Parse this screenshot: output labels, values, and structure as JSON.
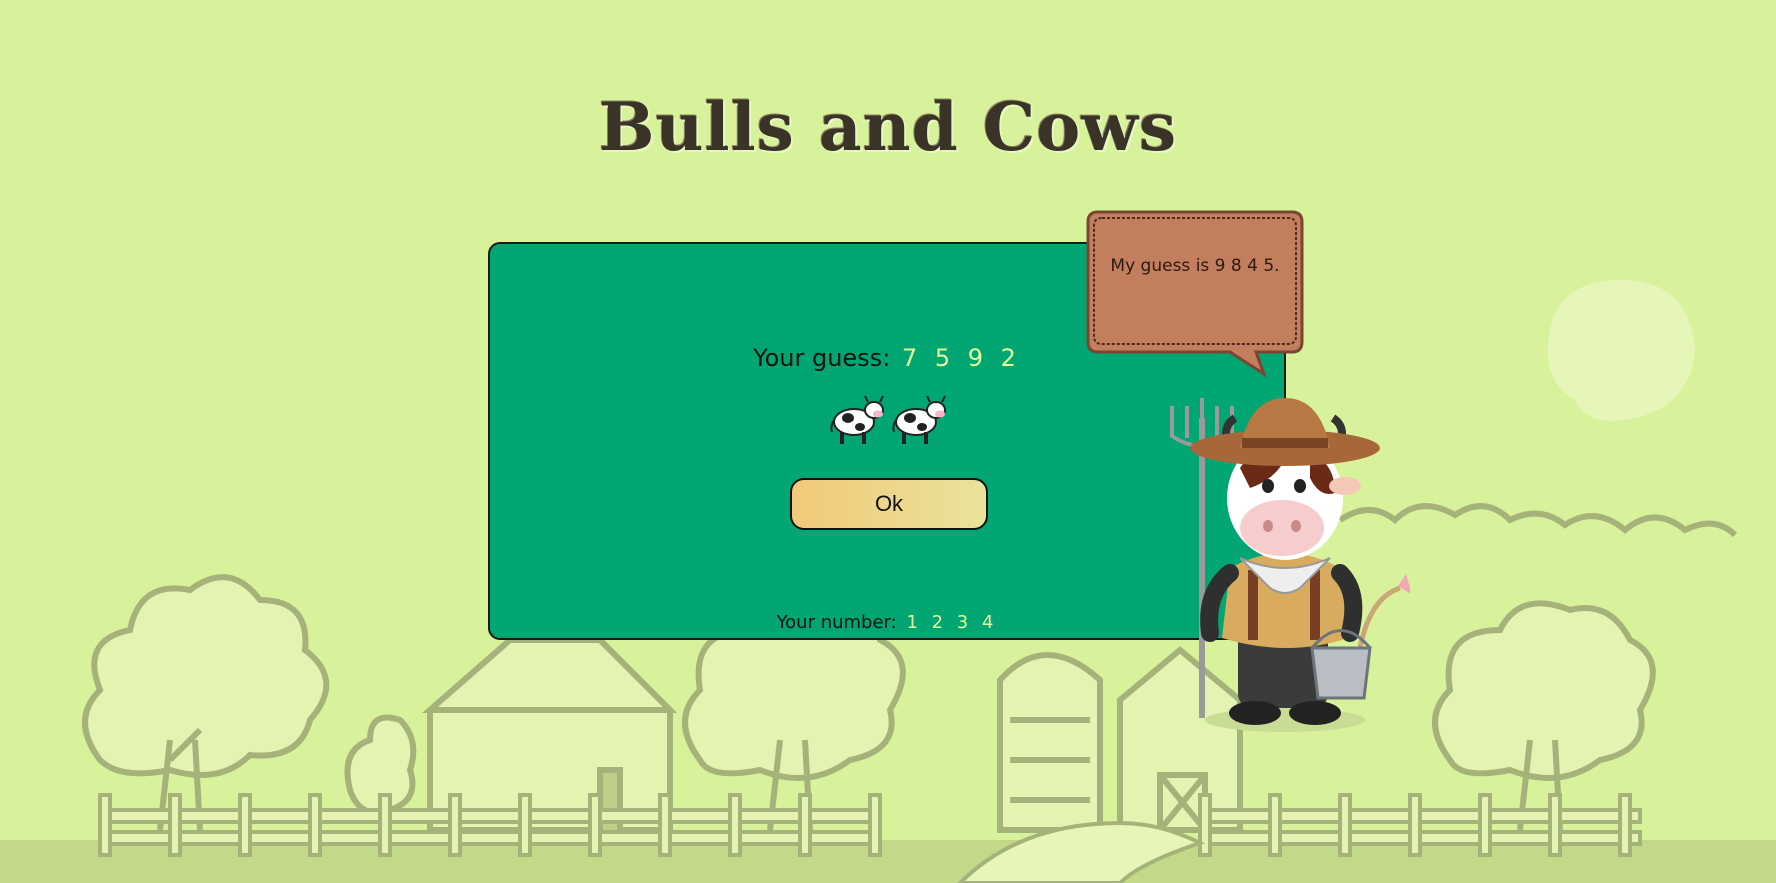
{
  "game": {
    "title": "Bulls and Cows",
    "your_guess_label": "Your guess:",
    "your_guess_digits": "7 5 9 2",
    "cow_count": 2,
    "ok_label": "Ok",
    "your_number_label": "Your number:",
    "your_number_digits": "1 2 3 4",
    "speech": "My guess is 9 8 4 5."
  },
  "colors": {
    "background": "#d8f29c",
    "panel": "#02a672",
    "digits": "#e4ff9a",
    "bubble": "#c07a5a",
    "scenery": "#a5b37a"
  },
  "icons": [
    "cow-icon",
    "farmer-cow-mascot",
    "speech-bubble"
  ]
}
